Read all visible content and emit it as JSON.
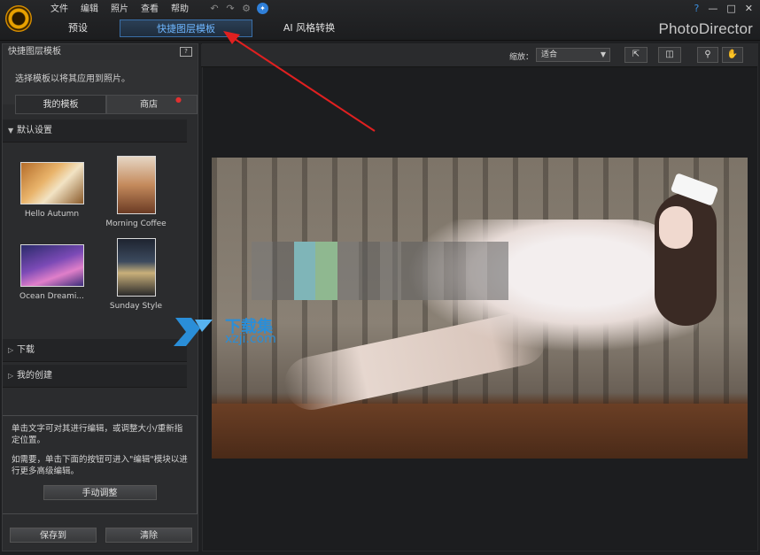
{
  "app": {
    "brand": "PhotoDirector"
  },
  "menu": [
    "文件",
    "编辑",
    "照片",
    "查看",
    "帮助"
  ],
  "window_controls": {
    "help": "?",
    "minimize": "—",
    "maximize": "□",
    "close": "✕"
  },
  "tabs": {
    "preset": "预设",
    "layer_templates": "快捷图层模板",
    "ai_style": "AI 风格转换"
  },
  "left_panel": {
    "title": "快捷图层模板",
    "help_label": "?",
    "description": "选择模板以将其应用到照片。",
    "subtabs": {
      "my_templates": "我的模板",
      "store": "商店"
    },
    "sections": {
      "default": "默认设置",
      "download": "下载",
      "my_creations": "我的创建"
    },
    "templates": [
      {
        "name": "Hello Autumn"
      },
      {
        "name": "Morning Coffee"
      },
      {
        "name": "Ocean Dreami..."
      },
      {
        "name": "Sunday Style"
      }
    ],
    "hint1": "单击文字可对其进行编辑，或调整大小/重新指定位置。",
    "hint2": "如需要，单击下面的按钮可进入\"编辑\"模块以进行更多高级编辑。",
    "manual_button": "手动调整",
    "save_button": "保存到",
    "clear_button": "清除"
  },
  "viewer": {
    "zoom_label": "缩放：",
    "zoom_value": "适合"
  },
  "watermark": {
    "line1": "下载集",
    "line2": "xzji.com"
  },
  "colors": {
    "accent": "#6eb6ff",
    "arrow": "#e02020",
    "logo": "#e8a100",
    "watermark": "#2a8ed8"
  }
}
